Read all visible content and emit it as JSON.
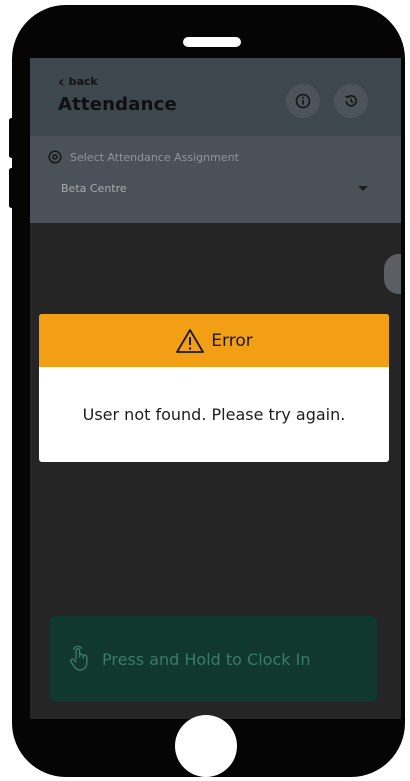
{
  "header": {
    "back_label": "back",
    "title": "Attendance",
    "info_icon": "info-icon",
    "history_icon": "history-icon"
  },
  "assignment": {
    "label": "Select Attendance Assignment",
    "selected": "Beta Centre"
  },
  "dialog": {
    "title": "Error",
    "message": "User not found. Please try again."
  },
  "clock_in": {
    "label": "Press and Hold to Clock In"
  },
  "colors": {
    "header_bg": "#3e464e",
    "dialog_header": "#f29f15",
    "clock_in_bg": "#10382c",
    "clock_in_text": "#3c7a68"
  }
}
